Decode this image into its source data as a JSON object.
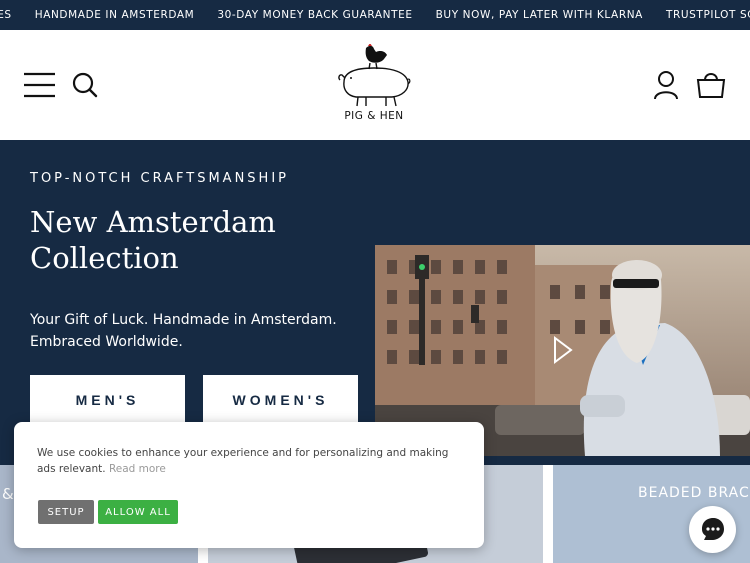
{
  "announcement_bar": {
    "items": [
      "NGES",
      "HANDMADE IN AMSTERDAM",
      "30-DAY MONEY BACK GUARANTEE",
      "BUY NOW, PAY LATER WITH KLARNA",
      "TRUSTPILOT SCORE"
    ]
  },
  "header": {
    "brand": "PIG & HEN",
    "icons": [
      "menu-icon",
      "search-icon",
      "account-icon",
      "cart-icon"
    ]
  },
  "hero": {
    "eyebrow": "TOP-NOTCH CRAFTSMANSHIP",
    "title_line1": "New Amsterdam",
    "title_line2": "Collection",
    "subtitle_line1": "Your Gift of Luck. Handmade in Amsterdam.",
    "subtitle_line2": "Embraced Worldwide.",
    "men_button": "MEN'S",
    "women_button": "WOMEN'S"
  },
  "category_tiles": {
    "left_label": "&",
    "right_label": "BEADED BRAC"
  },
  "cookie_banner": {
    "text": "We use cookies to enhance your experience and for personalizing and making ads relevant.",
    "read_more": "Read more",
    "setup_button": "SETUP",
    "allow_all_button": "ALLOW ALL"
  },
  "colors": {
    "navy": "#162a43",
    "allow_green": "#3cb043",
    "setup_gray": "#707070"
  }
}
